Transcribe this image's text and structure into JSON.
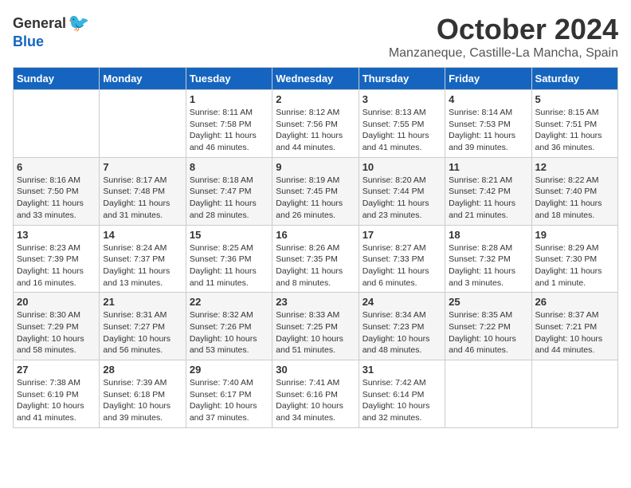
{
  "logo": {
    "general": "General",
    "blue": "Blue"
  },
  "title": "October 2024",
  "location": "Manzaneque, Castille-La Mancha, Spain",
  "headers": [
    "Sunday",
    "Monday",
    "Tuesday",
    "Wednesday",
    "Thursday",
    "Friday",
    "Saturday"
  ],
  "weeks": [
    [
      {
        "day": "",
        "info": ""
      },
      {
        "day": "",
        "info": ""
      },
      {
        "day": "1",
        "info": "Sunrise: 8:11 AM\nSunset: 7:58 PM\nDaylight: 11 hours and 46 minutes."
      },
      {
        "day": "2",
        "info": "Sunrise: 8:12 AM\nSunset: 7:56 PM\nDaylight: 11 hours and 44 minutes."
      },
      {
        "day": "3",
        "info": "Sunrise: 8:13 AM\nSunset: 7:55 PM\nDaylight: 11 hours and 41 minutes."
      },
      {
        "day": "4",
        "info": "Sunrise: 8:14 AM\nSunset: 7:53 PM\nDaylight: 11 hours and 39 minutes."
      },
      {
        "day": "5",
        "info": "Sunrise: 8:15 AM\nSunset: 7:51 PM\nDaylight: 11 hours and 36 minutes."
      }
    ],
    [
      {
        "day": "6",
        "info": "Sunrise: 8:16 AM\nSunset: 7:50 PM\nDaylight: 11 hours and 33 minutes."
      },
      {
        "day": "7",
        "info": "Sunrise: 8:17 AM\nSunset: 7:48 PM\nDaylight: 11 hours and 31 minutes."
      },
      {
        "day": "8",
        "info": "Sunrise: 8:18 AM\nSunset: 7:47 PM\nDaylight: 11 hours and 28 minutes."
      },
      {
        "day": "9",
        "info": "Sunrise: 8:19 AM\nSunset: 7:45 PM\nDaylight: 11 hours and 26 minutes."
      },
      {
        "day": "10",
        "info": "Sunrise: 8:20 AM\nSunset: 7:44 PM\nDaylight: 11 hours and 23 minutes."
      },
      {
        "day": "11",
        "info": "Sunrise: 8:21 AM\nSunset: 7:42 PM\nDaylight: 11 hours and 21 minutes."
      },
      {
        "day": "12",
        "info": "Sunrise: 8:22 AM\nSunset: 7:40 PM\nDaylight: 11 hours and 18 minutes."
      }
    ],
    [
      {
        "day": "13",
        "info": "Sunrise: 8:23 AM\nSunset: 7:39 PM\nDaylight: 11 hours and 16 minutes."
      },
      {
        "day": "14",
        "info": "Sunrise: 8:24 AM\nSunset: 7:37 PM\nDaylight: 11 hours and 13 minutes."
      },
      {
        "day": "15",
        "info": "Sunrise: 8:25 AM\nSunset: 7:36 PM\nDaylight: 11 hours and 11 minutes."
      },
      {
        "day": "16",
        "info": "Sunrise: 8:26 AM\nSunset: 7:35 PM\nDaylight: 11 hours and 8 minutes."
      },
      {
        "day": "17",
        "info": "Sunrise: 8:27 AM\nSunset: 7:33 PM\nDaylight: 11 hours and 6 minutes."
      },
      {
        "day": "18",
        "info": "Sunrise: 8:28 AM\nSunset: 7:32 PM\nDaylight: 11 hours and 3 minutes."
      },
      {
        "day": "19",
        "info": "Sunrise: 8:29 AM\nSunset: 7:30 PM\nDaylight: 11 hours and 1 minute."
      }
    ],
    [
      {
        "day": "20",
        "info": "Sunrise: 8:30 AM\nSunset: 7:29 PM\nDaylight: 10 hours and 58 minutes."
      },
      {
        "day": "21",
        "info": "Sunrise: 8:31 AM\nSunset: 7:27 PM\nDaylight: 10 hours and 56 minutes."
      },
      {
        "day": "22",
        "info": "Sunrise: 8:32 AM\nSunset: 7:26 PM\nDaylight: 10 hours and 53 minutes."
      },
      {
        "day": "23",
        "info": "Sunrise: 8:33 AM\nSunset: 7:25 PM\nDaylight: 10 hours and 51 minutes."
      },
      {
        "day": "24",
        "info": "Sunrise: 8:34 AM\nSunset: 7:23 PM\nDaylight: 10 hours and 48 minutes."
      },
      {
        "day": "25",
        "info": "Sunrise: 8:35 AM\nSunset: 7:22 PM\nDaylight: 10 hours and 46 minutes."
      },
      {
        "day": "26",
        "info": "Sunrise: 8:37 AM\nSunset: 7:21 PM\nDaylight: 10 hours and 44 minutes."
      }
    ],
    [
      {
        "day": "27",
        "info": "Sunrise: 7:38 AM\nSunset: 6:19 PM\nDaylight: 10 hours and 41 minutes."
      },
      {
        "day": "28",
        "info": "Sunrise: 7:39 AM\nSunset: 6:18 PM\nDaylight: 10 hours and 39 minutes."
      },
      {
        "day": "29",
        "info": "Sunrise: 7:40 AM\nSunset: 6:17 PM\nDaylight: 10 hours and 37 minutes."
      },
      {
        "day": "30",
        "info": "Sunrise: 7:41 AM\nSunset: 6:16 PM\nDaylight: 10 hours and 34 minutes."
      },
      {
        "day": "31",
        "info": "Sunrise: 7:42 AM\nSunset: 6:14 PM\nDaylight: 10 hours and 32 minutes."
      },
      {
        "day": "",
        "info": ""
      },
      {
        "day": "",
        "info": ""
      }
    ]
  ]
}
